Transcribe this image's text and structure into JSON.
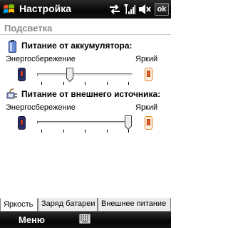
{
  "titlebar": {
    "title": "Настройка",
    "ok_label": "ok"
  },
  "section_title": "Подсветка",
  "battery": {
    "title": "Питание от аккумулятора:",
    "low_label": "Энергосбережение",
    "high_label": "Яркий",
    "level": 0.33,
    "ticks": 5
  },
  "external": {
    "title": "Питание от внешнего источника:",
    "low_label": "Энергосбережение",
    "high_label": "Яркий",
    "level": 1.0,
    "ticks": 5
  },
  "tabs": [
    {
      "label": "Яркость",
      "active": true
    },
    {
      "label": "Заряд батареи",
      "active": false
    },
    {
      "label": "Внешнее питание",
      "active": false
    }
  ],
  "menubar": {
    "left_label": "Меню"
  },
  "icons": [
    "windows-start-icon",
    "network-sync-icon",
    "signal-strength-icon",
    "speaker-muted-icon",
    "battery-icon",
    "power-plug-icon",
    "phone-dim-icon",
    "phone-bright-icon",
    "keyboard-icon"
  ],
  "colors": {
    "titlebar_bg": "#050505",
    "section_header": "#8c8c8c",
    "phone_dim": "#2b2f6a",
    "phone_bright": "#d97a16"
  }
}
